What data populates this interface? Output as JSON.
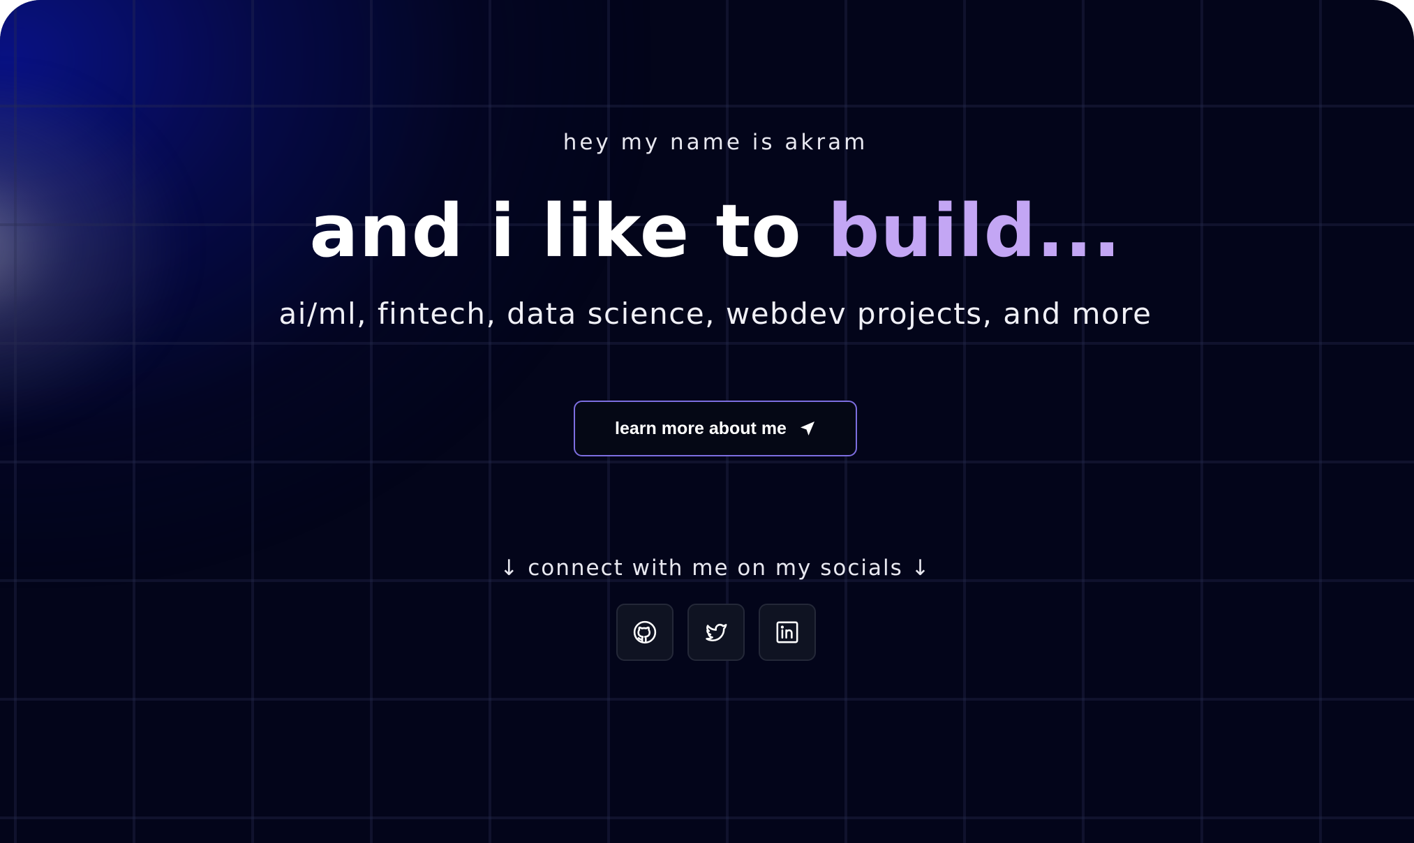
{
  "hero": {
    "intro": "hey my name is akram",
    "headline_main": "and i like to ",
    "headline_accent": "build...",
    "subline": "ai/ml, fintech, data science, webdev projects, and more",
    "cta_label": "learn more about me",
    "cta_icon": "send-icon"
  },
  "socials": {
    "label": "↓ connect with me on my socials ↓",
    "items": [
      {
        "name": "github",
        "icon": "github-icon"
      },
      {
        "name": "twitter",
        "icon": "twitter-icon"
      },
      {
        "name": "linkedin",
        "icon": "linkedin-icon"
      }
    ]
  },
  "colors": {
    "background": "#03051a",
    "accent": "#c3a6f4",
    "button_border": "#7d6ee0",
    "glow": "#0a1496"
  }
}
